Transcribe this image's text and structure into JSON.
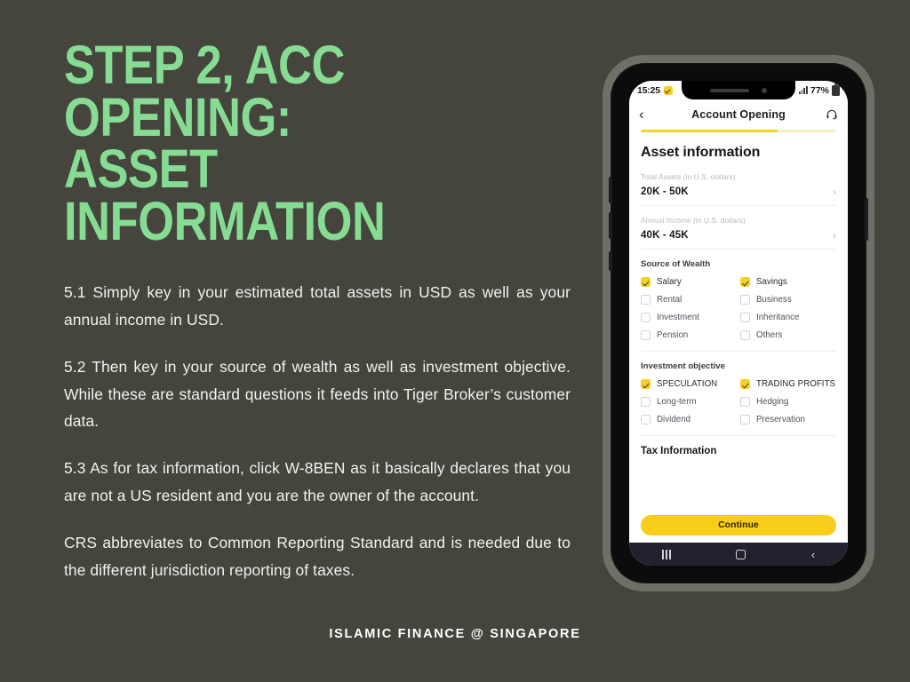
{
  "theme": {
    "background": "#45453E",
    "title_green": "#86DC93",
    "body_text": "#F2F2EE",
    "brand_yellow": "#F8CE1A",
    "checkbox_yellow": "#F6D02A",
    "nav_dark": "#22222E"
  },
  "slide": {
    "title": "STEP 2, ACC OPENING:\nASSET INFORMATION",
    "paragraphs": [
      "5.1 Simply key in your estimated total assets in USD as well as your annual income in USD.",
      "5.2 Then key in your source of wealth as well as investment objective. While these are standard questions it feeds into Tiger Broker’s customer data.",
      "5.3 As for tax information, click W-8BEN as it basically declares that you are not a US resident and you are the owner of the account.",
      "CRS abbreviates to Common Reporting Standard and is needed due to the different jurisdiction reporting of taxes."
    ],
    "footer": "ISLAMIC FINANCE @ SINGAPORE"
  },
  "phone": {
    "status_bar": {
      "time": "15:25",
      "badge_icon": "check-badge-icon",
      "signal_icon": "signal-bars-icon",
      "battery_percent": "77%",
      "battery_icon": "battery-icon"
    },
    "app_header": {
      "back_icon": "‹",
      "title": "Account Opening",
      "support_icon": "headset-icon"
    },
    "progress": {
      "percent": 70
    },
    "screen": {
      "section_title": "Asset information",
      "fields": [
        {
          "label": "Total Assets (in U.S. dollars)",
          "value": "20K - 50K",
          "chevron": "›"
        },
        {
          "label": "Annual Income (in U.S. dollars)",
          "value": "40K - 45K",
          "chevron": "›"
        }
      ],
      "source_of_wealth": {
        "title": "Source of Wealth",
        "options": [
          {
            "label": "Salary",
            "checked": true
          },
          {
            "label": "Savings",
            "checked": true
          },
          {
            "label": "Rental",
            "checked": false
          },
          {
            "label": "Business",
            "checked": false
          },
          {
            "label": "Investment",
            "checked": false
          },
          {
            "label": "Inheritance",
            "checked": false
          },
          {
            "label": "Pension",
            "checked": false
          },
          {
            "label": "Others",
            "checked": false
          }
        ]
      },
      "investment_objective": {
        "title": "Investment objective",
        "options": [
          {
            "label": "SPECULATION",
            "checked": true
          },
          {
            "label": "TRADING PROFITS",
            "checked": true
          },
          {
            "label": "Long-term",
            "checked": false
          },
          {
            "label": "Hedging",
            "checked": false
          },
          {
            "label": "Dividend",
            "checked": false
          },
          {
            "label": "Preservation",
            "checked": false
          }
        ]
      },
      "tax_section_title": "Tax Information",
      "cta_label": "Continue"
    },
    "nav_bar": {
      "recents_icon": "recents-icon",
      "home_icon": "home-icon",
      "back_icon": "‹"
    }
  }
}
